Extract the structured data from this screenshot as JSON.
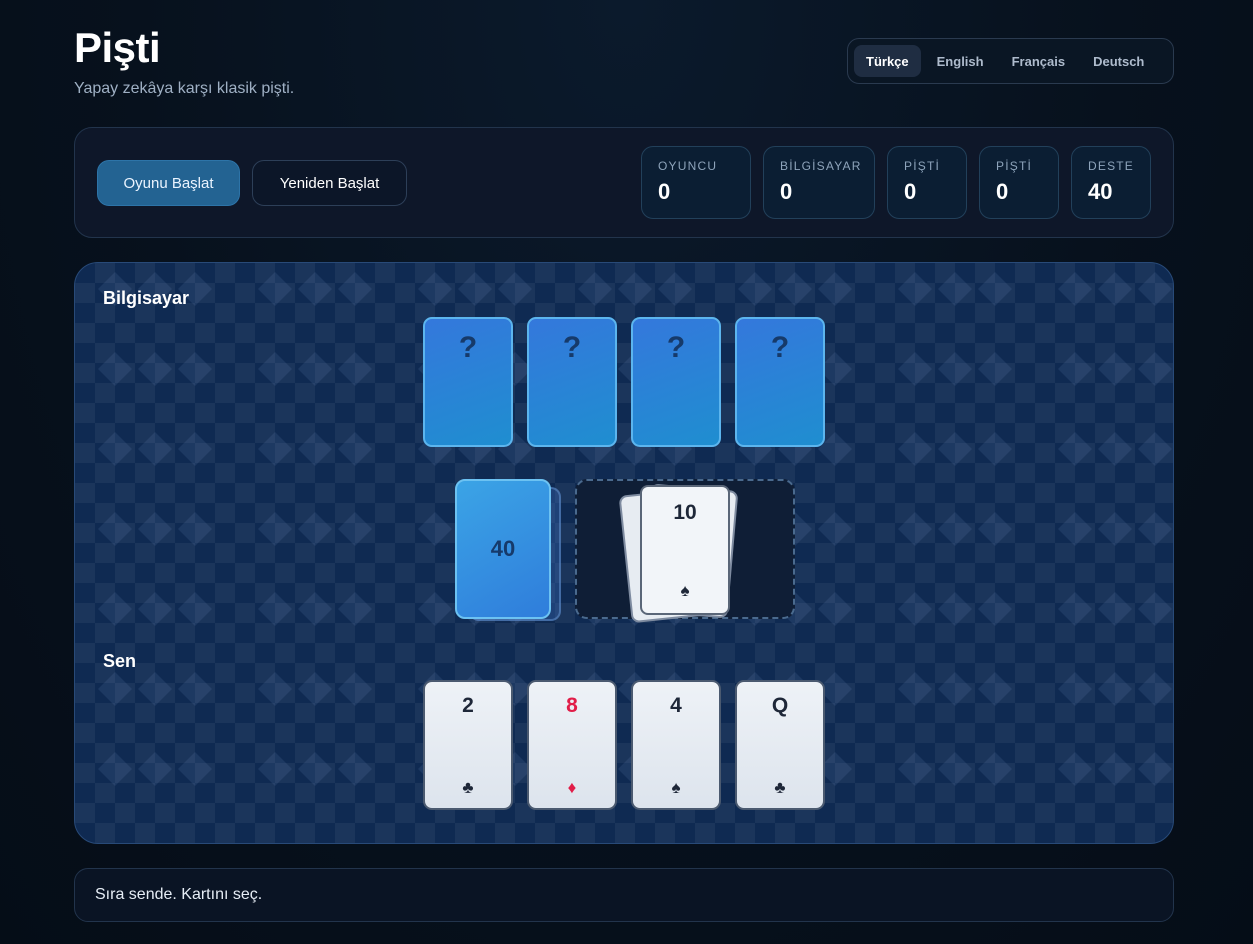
{
  "header": {
    "title": "Pişti",
    "subtitle": "Yapay zekâya karşı klasik pişti."
  },
  "languages": [
    {
      "label": "Türkçe",
      "active": true
    },
    {
      "label": "English",
      "active": false
    },
    {
      "label": "Français",
      "active": false
    },
    {
      "label": "Deutsch",
      "active": false
    }
  ],
  "controls": {
    "start_label": "Oyunu Başlat",
    "restart_label": "Yeniden Başlat"
  },
  "stats": [
    {
      "label": "OYUNCU",
      "value": "0"
    },
    {
      "label": "BİLGİSAYAR",
      "value": "0"
    },
    {
      "label": "PİŞTİ",
      "value": "0"
    },
    {
      "label": "PİŞTİ",
      "value": "0"
    },
    {
      "label": "DESTE",
      "value": "40"
    }
  ],
  "table": {
    "computer_label": "Bilgisayar",
    "player_label": "Sen",
    "computer_hand": [
      "?",
      "?",
      "?",
      "?"
    ],
    "deck_count": "40",
    "pile_top": {
      "rank": "10",
      "suit": "♠"
    },
    "player_hand": [
      {
        "rank": "2",
        "suit": "♣",
        "color": "black"
      },
      {
        "rank": "8",
        "suit": "♦",
        "color": "red"
      },
      {
        "rank": "4",
        "suit": "♠",
        "color": "black"
      },
      {
        "rank": "Q",
        "suit": "♣",
        "color": "black"
      }
    ]
  },
  "status": {
    "message": "Sıra sende. Kartını seç."
  },
  "colors": {
    "accent": "#236392",
    "table": "#0f2a52",
    "card_back": "#2f7ddb",
    "red_suit": "#e11d48"
  }
}
